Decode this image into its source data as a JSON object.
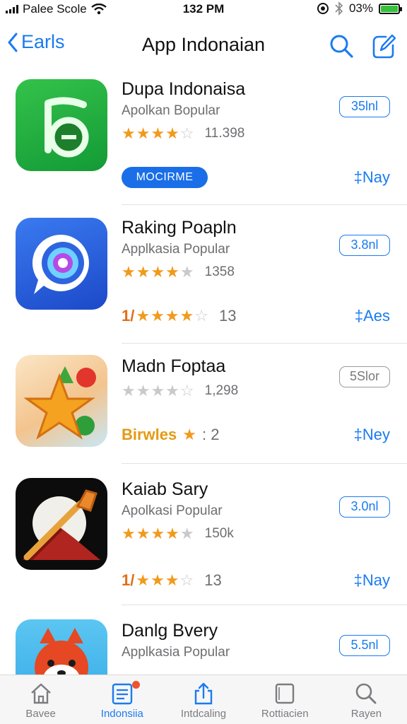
{
  "status_bar": {
    "carrier": "Palee Scole",
    "time": "132 PM",
    "battery": "03%"
  },
  "nav": {
    "back_label": "Earls",
    "title": "App Indonaian"
  },
  "apps": [
    {
      "name": "Dupa Indonaisa",
      "subtitle": "Apolkan Bopular",
      "rating_count": "11.398",
      "price": "35lnl",
      "badge": "MOCIRME",
      "action": "‡Nay",
      "rating": 4
    },
    {
      "name": "Raking Poapln",
      "subtitle": "Applkasia Popular",
      "rating_count": "1358",
      "price": "3.8nl",
      "bottom_prefix": "1/",
      "bottom_count": "13",
      "action": "‡Aes",
      "rating": 4.5
    },
    {
      "name": "Madn Foptaa",
      "subtitle": "",
      "rating_count": "1,298",
      "price": "5Slor",
      "bottom_prefix": "Birwles",
      "bottom_count": ": 2",
      "action": "‡Ney",
      "rating": 0
    },
    {
      "name": "Kaiab Sary",
      "subtitle": "Apolkasi Popular",
      "rating_count": "150k",
      "price": "3.0nl",
      "bottom_prefix": "1/",
      "bottom_count": "13",
      "action": "‡Nay",
      "rating": 4
    },
    {
      "name": "Danlg Bvery",
      "subtitle": "Applkasia Popular",
      "price": "5.5nl"
    }
  ],
  "tabs": [
    {
      "label": "Bavee",
      "icon": "home-icon",
      "active": false
    },
    {
      "label": "Indonsiia",
      "icon": "list-icon",
      "active": true
    },
    {
      "label": "Intdcaling",
      "icon": "share-icon",
      "active": false
    },
    {
      "label": "Rottiacien",
      "icon": "square-icon",
      "active": false
    },
    {
      "label": "Rayen",
      "icon": "search-icon",
      "active": false
    }
  ],
  "colors": {
    "accent": "#1a7bf0",
    "star": "#f19a1b",
    "badge": "#1a6ee8",
    "battery": "#35c13a"
  }
}
